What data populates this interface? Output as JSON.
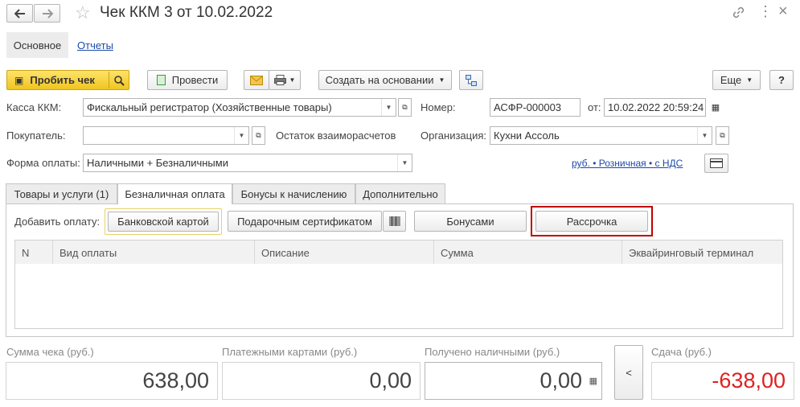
{
  "header": {
    "title": "Чек ККМ 3 от 10.02.2022"
  },
  "subnav": {
    "main_label": "Основное",
    "reports_label": "Отчеты"
  },
  "toolbar": {
    "punch_label": "Пробить чек",
    "post_label": "Провести",
    "create_based_label": "Создать на основании",
    "more_label": "Еще",
    "help_label": "?"
  },
  "form": {
    "kassa_label": "Касса ККМ:",
    "kassa_value": "Фискальный регистратор (Хозяйственные товары)",
    "number_label": "Номер:",
    "number_value": "АСФР-000003",
    "from_label": "от:",
    "date_value": "10.02.2022 20:59:24",
    "buyer_label": "Покупатель:",
    "buyer_value": "",
    "balance_label": "Остаток взаиморасчетов",
    "org_label": "Организация:",
    "org_value": "Кухни Ассоль",
    "payform_label": "Форма оплаты:",
    "payform_value": "Наличными + Безналичными",
    "price_link": "руб. • Розничная • с НДС"
  },
  "tabs": [
    {
      "label": "Товары и услуги (1)"
    },
    {
      "label": "Безналичная оплата"
    },
    {
      "label": "Бонусы к начислению"
    },
    {
      "label": "Дополнительно"
    }
  ],
  "payment": {
    "add_label": "Добавить оплату:",
    "bank_card": "Банковской картой",
    "gift_cert": "Подарочным сертификатом",
    "bonuses": "Бонусами",
    "installment": "Рассрочка"
  },
  "grid": {
    "columns": [
      "N",
      "Вид оплаты",
      "Описание",
      "Сумма",
      "Эквайринговый терминал"
    ]
  },
  "totals": {
    "check_sum_label": "Сумма чека (руб.)",
    "check_sum_value": "638,00",
    "card_label": "Платежными картами (руб.)",
    "card_value": "0,00",
    "cash_label": "Получено наличными (руб.)",
    "cash_value": "0,00",
    "change_btn": "<",
    "change_label": "Сдача (руб.)",
    "change_value": "-638,00"
  },
  "colors": {
    "accent_yellow": "#f5d23c",
    "highlight_red": "#c00000",
    "negative_red": "#e02020",
    "link_blue": "#1c4aa8"
  }
}
